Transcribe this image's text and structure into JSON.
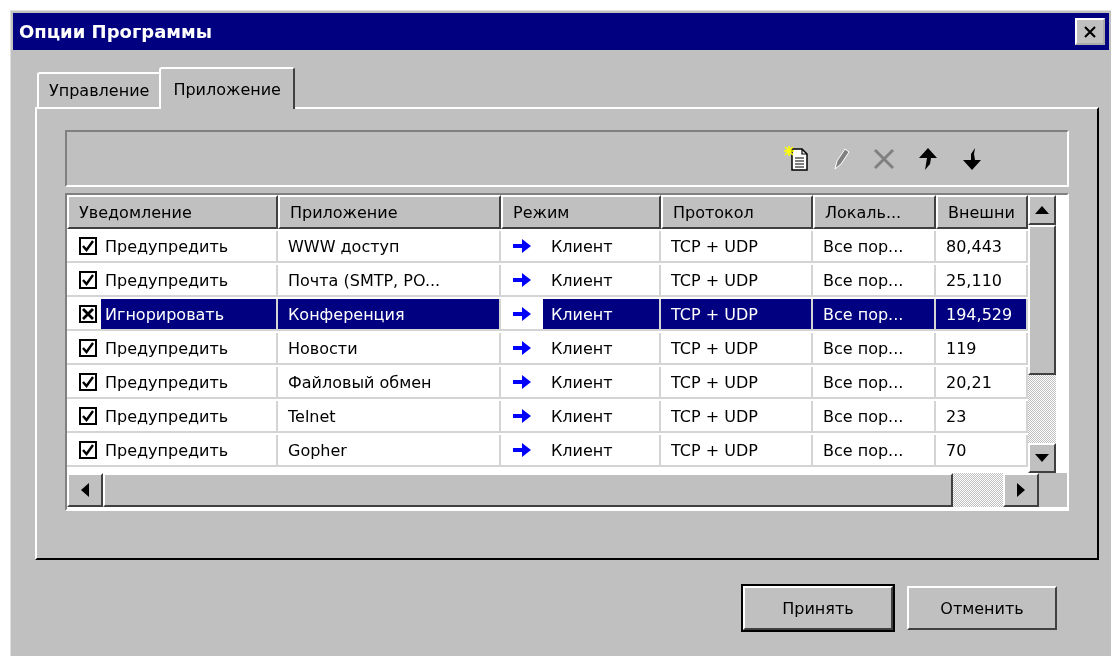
{
  "window": {
    "title": "Опции Программы"
  },
  "tabs": [
    {
      "label": "Управление",
      "selected": false
    },
    {
      "label": "Приложение",
      "selected": true
    }
  ],
  "toolbar": [
    {
      "kind": "new",
      "disabled": false
    },
    {
      "kind": "edit",
      "disabled": true
    },
    {
      "kind": "delete",
      "disabled": true
    },
    {
      "kind": "up",
      "disabled": false
    },
    {
      "kind": "down",
      "disabled": false
    }
  ],
  "table": {
    "columns": [
      "Уведомление",
      "Приложение",
      "Режим",
      "Протокол",
      "Локаль...",
      "Внешни"
    ],
    "rows": [
      {
        "selected": false,
        "checked": true,
        "kind": "tick",
        "notification": "Предупредить",
        "application": "WWW доступ",
        "mode": "Клиент",
        "protocol": "TCP + UDP",
        "local": "Все пор...",
        "external": "80,443"
      },
      {
        "selected": false,
        "checked": true,
        "kind": "tick",
        "notification": "Предупредить",
        "application": "Почта (SMTP, PO...",
        "mode": "Клиент",
        "protocol": "TCP + UDP",
        "local": "Все пор...",
        "external": "25,110"
      },
      {
        "selected": true,
        "checked": true,
        "kind": "cross",
        "notification": "Игнорировать",
        "application": "Конференция",
        "mode": "Клиент",
        "protocol": "TCP + UDP",
        "local": "Все пор...",
        "external": "194,529"
      },
      {
        "selected": false,
        "checked": true,
        "kind": "tick",
        "notification": "Предупредить",
        "application": "Новости",
        "mode": "Клиент",
        "protocol": "TCP + UDP",
        "local": "Все пор...",
        "external": "119"
      },
      {
        "selected": false,
        "checked": true,
        "kind": "tick",
        "notification": "Предупредить",
        "application": "Файловый обмен",
        "mode": "Клиент",
        "protocol": "TCP + UDP",
        "local": "Все пор...",
        "external": "20,21"
      },
      {
        "selected": false,
        "checked": true,
        "kind": "tick",
        "notification": "Предупредить",
        "application": "Telnet",
        "mode": "Клиент",
        "protocol": "TCP + UDP",
        "local": "Все пор...",
        "external": "23"
      },
      {
        "selected": false,
        "checked": true,
        "kind": "tick",
        "notification": "Предупредить",
        "application": "Gopher",
        "mode": "Клиент",
        "protocol": "TCP + UDP",
        "local": "Все пор...",
        "external": "70"
      }
    ]
  },
  "buttons": [
    {
      "label": "Принять",
      "default": true
    },
    {
      "label": "Отменить",
      "default": false
    }
  ]
}
